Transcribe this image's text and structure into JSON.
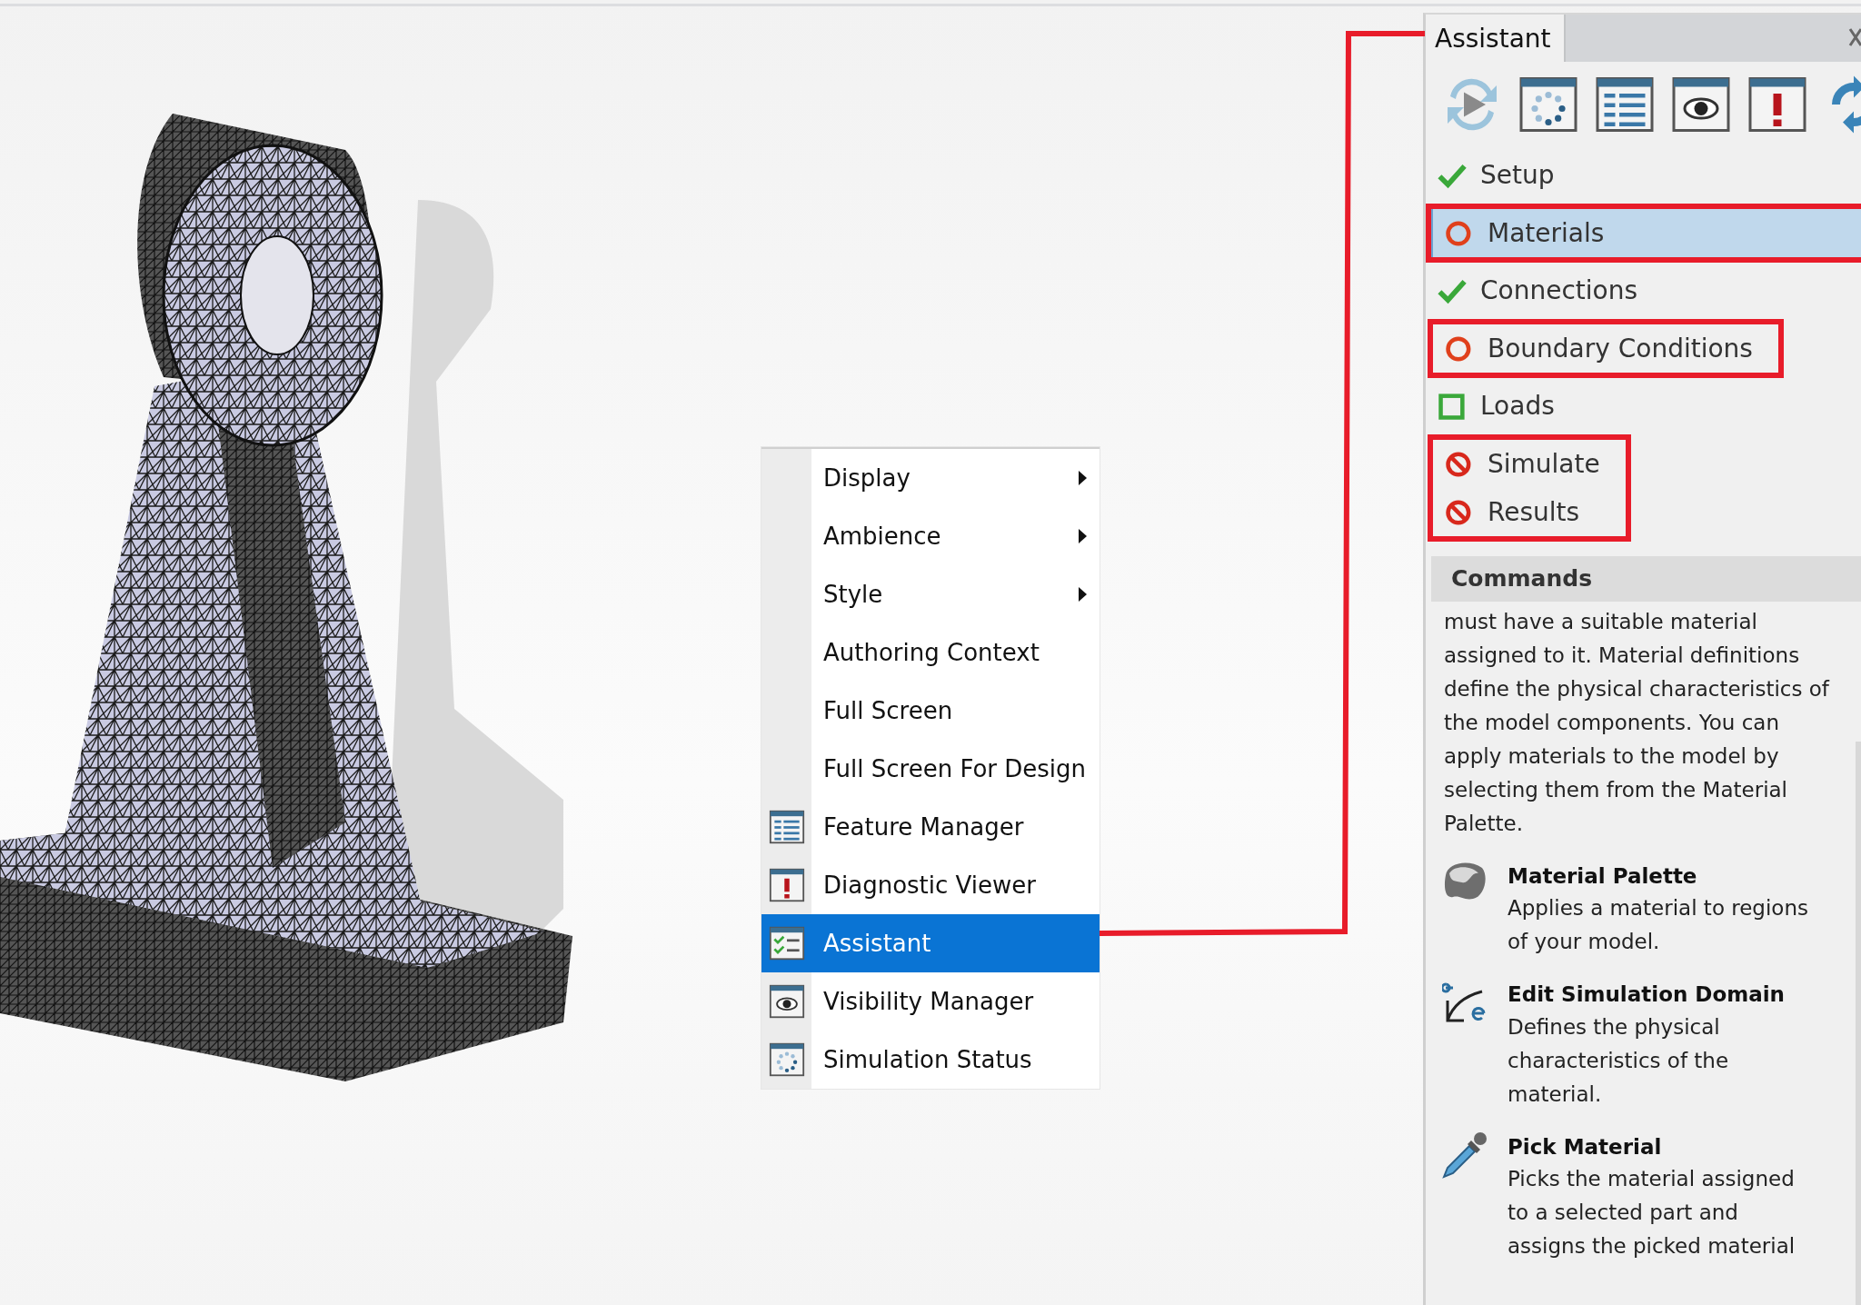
{
  "context_menu": {
    "items": [
      {
        "label": "Display",
        "submenu": true,
        "selected": false
      },
      {
        "label": "Ambience",
        "submenu": true,
        "selected": false
      },
      {
        "label": "Style",
        "submenu": true,
        "selected": false
      },
      {
        "label": "Authoring Context",
        "submenu": false,
        "selected": false
      },
      {
        "label": "Full Screen",
        "submenu": false,
        "selected": false
      },
      {
        "label": "Full Screen For Design",
        "submenu": false,
        "selected": false
      },
      {
        "label": "Feature Manager",
        "submenu": false,
        "selected": false
      },
      {
        "label": "Diagnostic Viewer",
        "submenu": false,
        "selected": false
      },
      {
        "label": "Assistant",
        "submenu": false,
        "selected": true
      },
      {
        "label": "Visibility Manager",
        "submenu": false,
        "selected": false
      },
      {
        "label": "Simulation Status",
        "submenu": false,
        "selected": false
      }
    ]
  },
  "panel": {
    "tab": "Assistant",
    "steps": [
      {
        "label": "Setup",
        "kind": "done",
        "selected": false,
        "outlined": false
      },
      {
        "label": "Materials",
        "kind": "pending",
        "selected": true,
        "outlined": true
      },
      {
        "label": "Connections",
        "kind": "done",
        "selected": false,
        "outlined": false
      },
      {
        "label": "Boundary Conditions",
        "kind": "pending",
        "selected": false,
        "outlined": true
      },
      {
        "label": "Loads",
        "kind": "optional",
        "selected": false,
        "outlined": false
      },
      {
        "label": "Simulate",
        "kind": "blocked",
        "selected": false,
        "outlined": true
      },
      {
        "label": "Results",
        "kind": "blocked",
        "selected": false,
        "outlined": true
      }
    ],
    "commands_header": "Commands",
    "description": "must have a suitable material assigned to it. Material definitions define the physical characteristics of the model components. You can apply materials to the model by selecting them from the Material Palette.",
    "commands": [
      {
        "title": "Material Palette",
        "description": "Applies a material to regions of your model."
      },
      {
        "title": "Edit Simulation Domain",
        "description": "Defines the physical characteristics of the material."
      },
      {
        "title": "Pick Material",
        "description": "Picks the material assigned to a selected part and assigns the picked material"
      }
    ]
  }
}
